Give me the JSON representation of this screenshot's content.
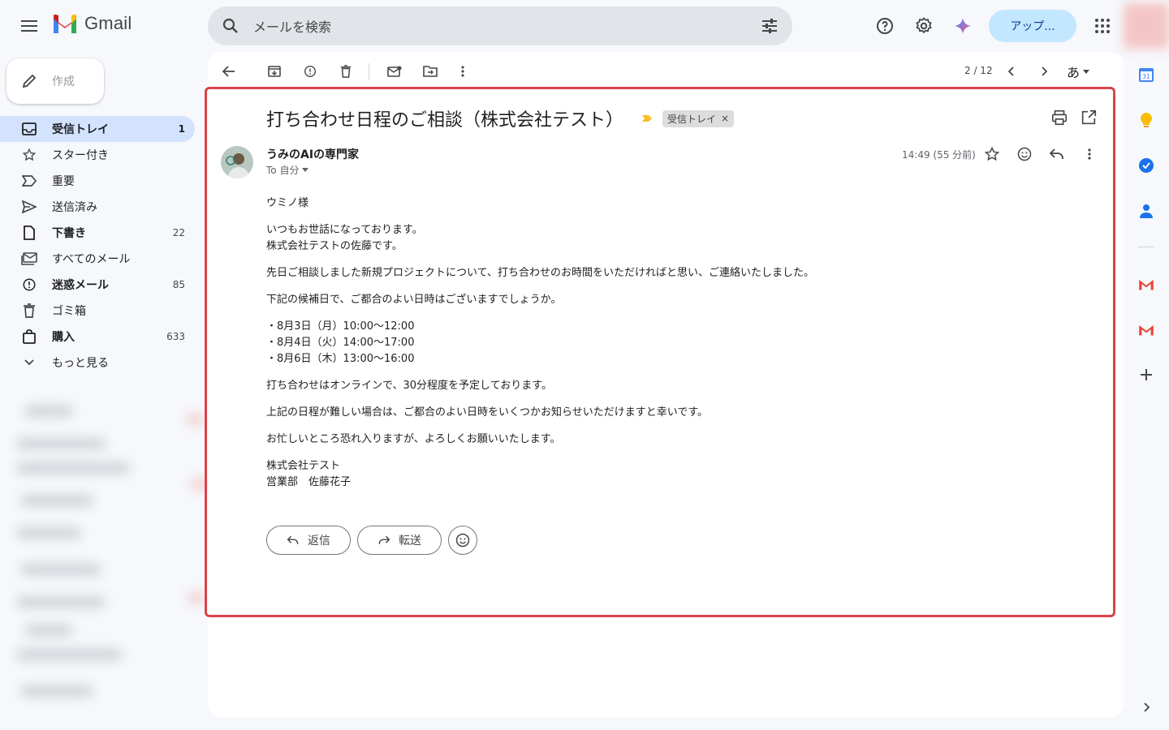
{
  "app": {
    "name": "Gmail"
  },
  "search": {
    "placeholder": "メールを検索"
  },
  "header": {
    "upgrade_label": "アップ..."
  },
  "compose": {
    "label": "作成"
  },
  "sidebar": {
    "items": [
      {
        "label": "受信トレイ",
        "count": "1",
        "icon": "inbox-icon"
      },
      {
        "label": "スター付き",
        "count": "",
        "icon": "star-icon"
      },
      {
        "label": "重要",
        "count": "",
        "icon": "important-icon"
      },
      {
        "label": "送信済み",
        "count": "",
        "icon": "send-icon"
      },
      {
        "label": "下書き",
        "count": "22",
        "icon": "draft-icon"
      },
      {
        "label": "すべてのメール",
        "count": "",
        "icon": "all-mail-icon"
      },
      {
        "label": "迷惑メール",
        "count": "85",
        "icon": "spam-icon"
      },
      {
        "label": "ゴミ箱",
        "count": "",
        "icon": "trash-icon"
      },
      {
        "label": "購入",
        "count": "633",
        "icon": "purchase-icon"
      },
      {
        "label": "もっと見る",
        "count": "",
        "icon": "expand-icon"
      }
    ]
  },
  "toolbar": {
    "pager": "2 / 12",
    "input_tool": "あ"
  },
  "email": {
    "subject": "打ち合わせ日程のご相談（株式会社テスト）",
    "label_chip": "受信トレイ",
    "label_chip_close": "×",
    "sender_name": "うみのAIの専門家",
    "to_line": "To 自分",
    "time": "14:49 (55 分前)",
    "body": {
      "greeting": "ウミノ様",
      "intro_1": "いつもお世話になっております。",
      "intro_2": "株式会社テストの佐藤です。",
      "para_1": "先日ご相談しました新規プロジェクトについて、打ち合わせのお時間をいただければと思い、ご連絡いたしました。",
      "para_2": "下記の候補日で、ご都合のよい日時はございますでしょうか。",
      "option_1": "・8月3日（月）10:00〜12:00",
      "option_2": "・8月4日（火）14:00〜17:00",
      "option_3": "・8月6日（木）13:00〜16:00",
      "para_3": "打ち合わせはオンラインで、30分程度を予定しております。",
      "para_4": "上記の日程が難しい場合は、ご都合のよい日時をいくつかお知らせいただけますと幸いです。",
      "para_5": "お忙しいところ恐れ入りますが、よろしくお願いいたします。",
      "sig_1": "株式会社テスト",
      "sig_2": "営業部　佐藤花子"
    },
    "reply_label": "返信",
    "forward_label": "転送"
  },
  "colors": {
    "accent": "#d9444b",
    "upgrade_bg": "#c2e7ff",
    "active_nav": "#d3e3fd",
    "search_bg": "#e1e4e9"
  }
}
